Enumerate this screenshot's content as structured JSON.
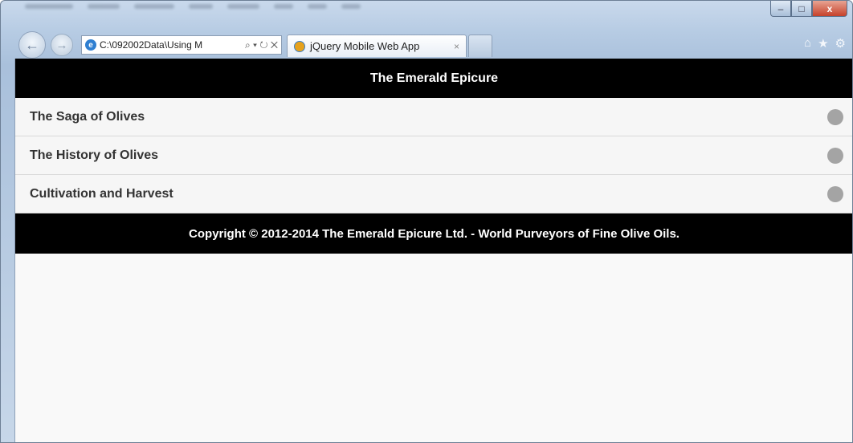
{
  "browser": {
    "address_url": "C:\\092002Data\\Using M",
    "address_controls": "⌕ ▾ ↻ ✕",
    "tab_title": "jQuery Mobile Web App",
    "tab_close": "×",
    "window_controls": {
      "minimize": "–",
      "maximize": "□",
      "close": "x"
    },
    "toolbar_icons": {
      "home": "⌂",
      "favorites": "★",
      "settings": "⚙"
    }
  },
  "page": {
    "header_title": "The Emerald Epicure",
    "items": [
      {
        "label": "The Saga of Olives"
      },
      {
        "label": "The History of Olives"
      },
      {
        "label": "Cultivation and Harvest"
      }
    ],
    "footer_text": "Copyright © 2012-2014 The Emerald Epicure Ltd. - World Purveyors of Fine Olive Oils."
  },
  "colors": {
    "header_bg": "#000000",
    "list_bg": "#f6f6f6",
    "bullet": "#a4a4a4",
    "window_chrome": "#b6cbe3"
  }
}
